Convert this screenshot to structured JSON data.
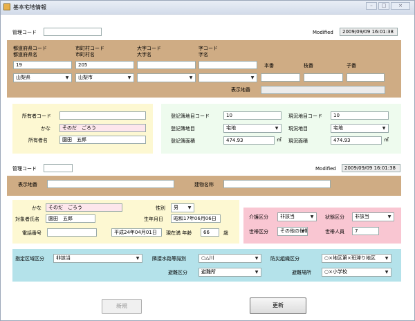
{
  "window": {
    "title": "基本宅地情報"
  },
  "section1": {
    "kanri_label": "管理コード",
    "kanri_value": "",
    "modified_label": "Modified",
    "modified_value": "2009/09/09 16:01:38"
  },
  "address": {
    "pref_code_label": "都道府県コード",
    "pref_name_label": "都道府県名",
    "pref_code": "19",
    "pref_name": "山梨県",
    "city_code_label": "市町村コード",
    "city_name_label": "市町村名",
    "city_code": "205",
    "city_name": "山梨市",
    "ooaza_code_label": "大字コード",
    "ooaza_name_label": "大字名",
    "aza_code_label": "字コード",
    "aza_name_label": "字名",
    "honban_label": "本番",
    "edaban_label": "枝番",
    "koban_label": "子番",
    "hyoji_label": "表示地番"
  },
  "owner": {
    "code_label": "所有者コード",
    "code_value": "",
    "kana_label": "かな",
    "kana_value": "そのだ　ごろう",
    "name_label": "所有者名",
    "name_value": "園田　五郎"
  },
  "land": {
    "touki_code_label": "登記簿地目コード",
    "touki_code_value": "10",
    "touki_label": "登記簿地目",
    "touki_value": "宅地",
    "touki_area_label": "登記簿面積",
    "touki_area_value": "474.93",
    "genkyo_code_label": "現況地目コード",
    "genkyo_code_value": "10",
    "genkyo_label": "現況地目",
    "genkyo_value": "宅地",
    "genkyo_area_label": "現況面積",
    "genkyo_area_value": "474.93",
    "unit": "㎡"
  },
  "section2": {
    "kanri_label": "管理コード",
    "kanri_value": "",
    "modified_label": "Modified",
    "modified_value": "2009/09/09 16:01:38",
    "hyoji_label": "表示地番",
    "tatemono_label": "建物名称"
  },
  "person": {
    "kana_label": "かな",
    "kana_value": "そのだ　ごろう",
    "name_label": "対象者氏名",
    "name_value": "園田　五郎",
    "tel_label": "電話番号",
    "tel_value": "",
    "sex_label": "性別",
    "sex_value": "男",
    "birth_label": "生年月日",
    "birth_value": "昭和17年06月06日",
    "asof_value": "平成24年04月01日",
    "age_label": "現在満 年齢",
    "age_value": "66",
    "age_unit": "歳"
  },
  "care": {
    "kaigo_label": "介護区分",
    "kaigo_value": "非該当",
    "jotai_label": "状態区分",
    "jotai_value": "非該当",
    "setai_label": "世帯区分",
    "setai_value": "その他の世帯",
    "setai_num_label": "世帯人員",
    "setai_num_value": "7"
  },
  "area": {
    "shitei_label": "指定区域区分",
    "shitei_value": "非該当",
    "rinsetsu_label": "隣接水路等識別",
    "rinsetsu_value": "○△川",
    "bousai_label": "防災組織区分",
    "bousai_value": "○×地区第×班滞り地区",
    "hinan_kubun_label": "避難区分",
    "hinan_kubun_value": "避難所",
    "hinan_basho_label": "避難場所",
    "hinan_basho_value": "○×小学校"
  },
  "buttons": {
    "new_label": "新規",
    "update_label": "更新"
  },
  "colors": {
    "tan": "#cfac84",
    "cream": "#fdf8d2",
    "mint": "#eefbee",
    "pink": "#f9c6d2",
    "cyan": "#b4e2ea"
  }
}
